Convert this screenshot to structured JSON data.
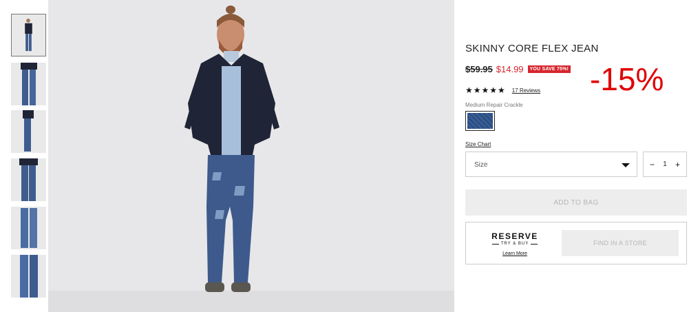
{
  "product": {
    "title": "SKINNY CORE FLEX JEAN",
    "price_old": "$59.95",
    "price_new": "$14.99",
    "save_badge": "YOU SAVE 75%!",
    "discount_overlay": "-15%",
    "stars": "★★★★★",
    "rating_value": 5,
    "reviews_label": "17 Reviews",
    "color_label": "Medium Repair Crackle"
  },
  "size": {
    "chart_link": "Size Chart",
    "select_label": "Size",
    "selected_value": ""
  },
  "quantity": {
    "minus": "−",
    "value": "1",
    "plus": "+"
  },
  "actions": {
    "add_to_bag": "ADD TO BAG",
    "reserve_title": "RESERVE",
    "reserve_sub": "TRY & BUY",
    "learn_more": "Learn More",
    "find_in_store": "FIND IN A STORE"
  },
  "gallery": {
    "thumbnail_count": 6,
    "active_index": 0
  },
  "colors": {
    "sale_red": "#d6252d",
    "discount_red": "#e00000",
    "disabled_bg": "#ededed",
    "disabled_text": "#b5b5b5"
  }
}
